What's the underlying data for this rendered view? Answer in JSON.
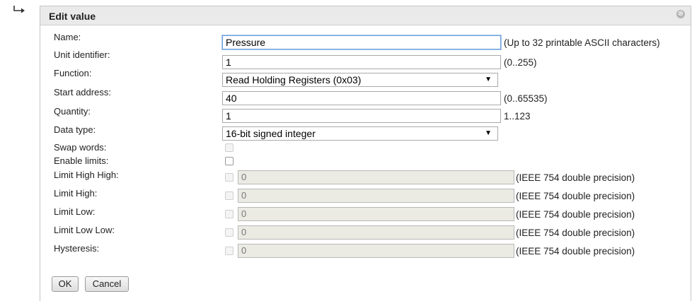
{
  "dialog": {
    "title": "Edit value",
    "close_glyph": "⊗"
  },
  "fields": {
    "name": {
      "label": "Name:",
      "value": "Pressure",
      "hint": "(Up to 32 printable ASCII characters)"
    },
    "unit": {
      "label": "Unit identifier:",
      "value": "1",
      "hint": "(0..255)"
    },
    "function": {
      "label": "Function:",
      "selected": "Read Holding Registers (0x03)"
    },
    "start": {
      "label": "Start address:",
      "value": "40",
      "hint": "(0..65535)"
    },
    "quantity": {
      "label": "Quantity:",
      "value": "1",
      "hint": "1..123"
    },
    "data_type": {
      "label": "Data type:",
      "selected": "16-bit signed integer"
    },
    "swap_words": {
      "label": "Swap words:",
      "checked": false,
      "disabled": true
    },
    "enable_limits": {
      "label": "Enable limits:",
      "checked": false,
      "disabled": false
    }
  },
  "limits": [
    {
      "label": "Limit High High:",
      "value": "0",
      "hint": "(IEEE 754 double precision)"
    },
    {
      "label": "Limit High:",
      "value": "0",
      "hint": "(IEEE 754 double precision)"
    },
    {
      "label": "Limit Low:",
      "value": "0",
      "hint": "(IEEE 754 double precision)"
    },
    {
      "label": "Limit Low Low:",
      "value": "0",
      "hint": "(IEEE 754 double precision)"
    },
    {
      "label": "Hysteresis:",
      "value": "0",
      "hint": "(IEEE 754 double precision)"
    }
  ],
  "buttons": {
    "ok": "OK",
    "cancel": "Cancel"
  },
  "icons": {
    "arrow": "return-arrow-icon",
    "close": "close-icon",
    "caret": "dropdown-caret-icon"
  },
  "colors": {
    "focus_border": "#6b9fd8",
    "disabled_bg": "#ebebe4",
    "titlebar_bg": "#eaeaea"
  }
}
